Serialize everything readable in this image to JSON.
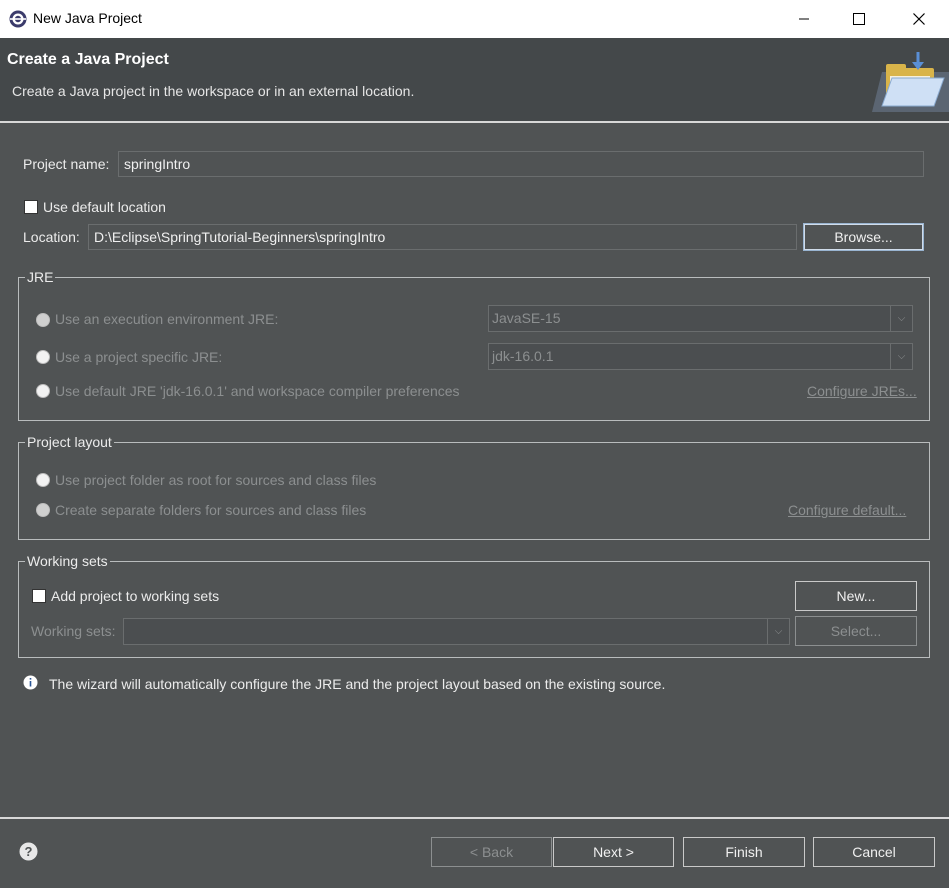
{
  "window": {
    "title": "New Java Project",
    "minimize_icon": "minimize-icon",
    "maximize_icon": "maximize-icon",
    "close_icon": "close-icon"
  },
  "header": {
    "title": "Create a Java Project",
    "description": "Create a Java project in the workspace or in an external location."
  },
  "project": {
    "name_label": "Project name:",
    "name_value": "springIntro",
    "use_default_location_label": "Use default location",
    "use_default_location_checked": false,
    "location_label": "Location:",
    "location_value": "D:\\Eclipse\\SpringTutorial-Beginners\\springIntro",
    "browse_label": "Browse..."
  },
  "jre": {
    "group_title": "JRE",
    "options": [
      {
        "label": "Use an execution environment JRE:",
        "combo": "JavaSE-15",
        "selected": true
      },
      {
        "label": "Use a project specific JRE:",
        "combo": "jdk-16.0.1",
        "selected": false
      },
      {
        "label": "Use default JRE 'jdk-16.0.1' and workspace compiler preferences",
        "selected": false
      }
    ],
    "configure_link": "Configure JREs..."
  },
  "layout": {
    "group_title": "Project layout",
    "options": [
      {
        "label": "Use project folder as root for sources and class files",
        "selected": false
      },
      {
        "label": "Create separate folders for sources and class files",
        "selected": true
      }
    ],
    "configure_link": "Configure default..."
  },
  "working_sets": {
    "group_title": "Working sets",
    "add_label": "Add project to working sets",
    "add_checked": false,
    "new_button": "New...",
    "sets_label": "Working sets:",
    "select_button": "Select..."
  },
  "info": {
    "icon": "info-icon",
    "text": "The wizard will automatically configure the JRE and the project layout based on the existing source."
  },
  "footer": {
    "help_icon": "help-icon",
    "back_label": "< Back",
    "next_label": "Next >",
    "finish_label": "Finish",
    "cancel_label": "Cancel"
  },
  "colors": {
    "dialog_bg": "#505354",
    "header_bg": "#44484a",
    "focus_border": "#99b4d1"
  }
}
